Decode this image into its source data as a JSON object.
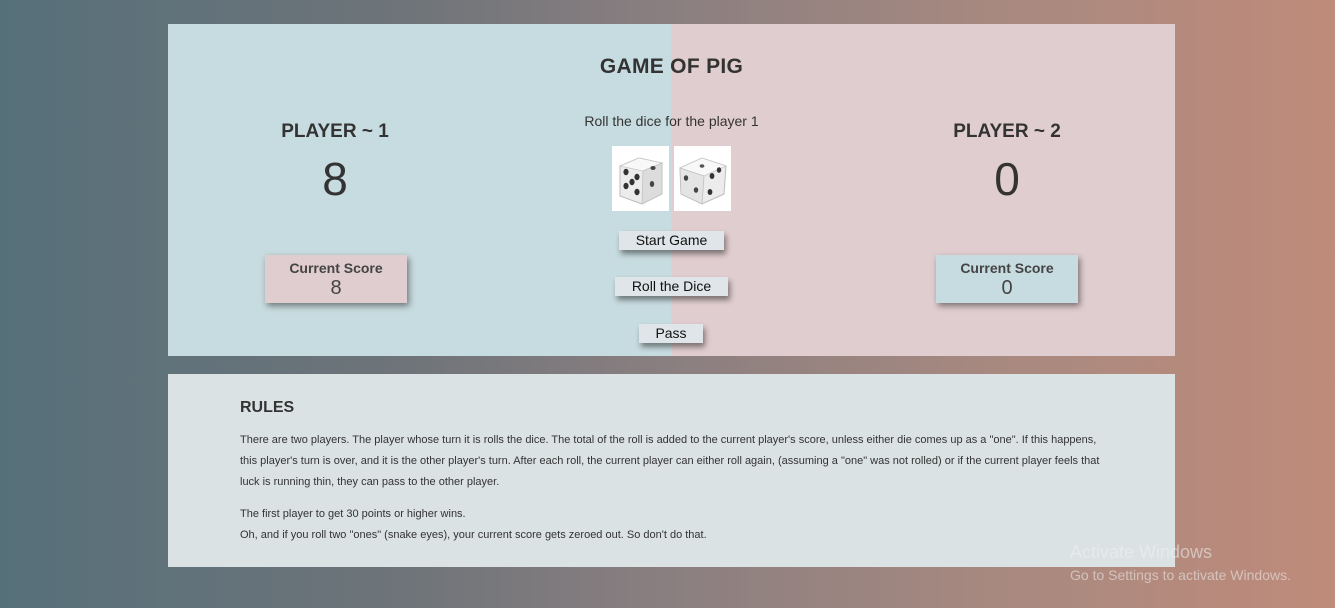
{
  "game": {
    "title": "GAME OF PIG",
    "message": "Roll the dice for the player 1",
    "players": [
      {
        "name": "PLAYER ~ 1",
        "score": "8",
        "current_label": "Current Score",
        "current_value": "8"
      },
      {
        "name": "PLAYER ~ 2",
        "score": "0",
        "current_label": "Current Score",
        "current_value": "0"
      }
    ],
    "dice": [
      5,
      3
    ],
    "buttons": {
      "start": "Start Game",
      "roll": "Roll the Dice",
      "pass": "Pass"
    }
  },
  "rules": {
    "title": "RULES",
    "paragraph1": "There are two players. The player whose turn it is rolls the dice. The total of the roll is added to the current player's score, unless either die comes up as a \"one\". If this happens, this player's turn is over, and it is the other player's turn. After each roll, the current player can either roll again, (assuming a \"one\" was not rolled) or if the current player feels that luck is running thin, they can pass to the other player.",
    "paragraph2": "The first player to get 30 points or higher wins.",
    "paragraph3": "Oh, and if you roll two \"ones\" (snake eyes), your current score gets zeroed out. So don't do that."
  },
  "watermark": {
    "line1": "Activate Windows",
    "line2": "Go to Settings to activate Windows."
  }
}
